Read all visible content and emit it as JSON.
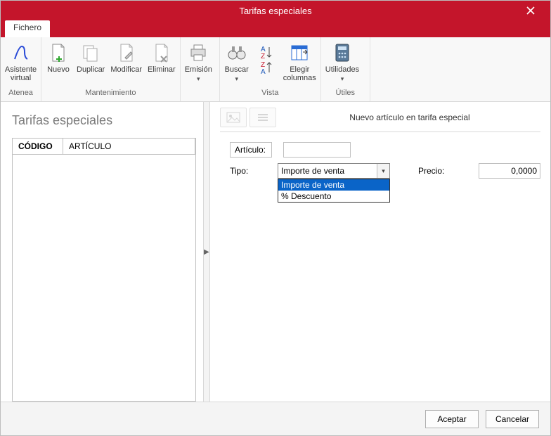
{
  "window": {
    "title": "Tarifas especiales"
  },
  "tabs": {
    "file": "Fichero"
  },
  "ribbon": {
    "group_atenea": {
      "label": "Atenea",
      "buttons": {
        "asistente": "Asistente\nvirtual"
      }
    },
    "group_mant": {
      "label": "Mantenimiento",
      "buttons": {
        "nuevo": "Nuevo",
        "duplicar": "Duplicar",
        "modificar": "Modificar",
        "eliminar": "Eliminar"
      }
    },
    "group_emision": {
      "label": "",
      "buttons": {
        "emision": "Emisión"
      }
    },
    "group_vista": {
      "label": "Vista",
      "buttons": {
        "buscar": "Buscar",
        "sort": "",
        "elegir": "Elegir\ncolumnas"
      }
    },
    "group_utiles": {
      "label": "Útiles",
      "buttons": {
        "utilidades": "Utilidades"
      }
    }
  },
  "left": {
    "title": "Tarifas especiales",
    "columns": {
      "codigo": "CÓDIGO",
      "articulo": "ARTÍCULO"
    }
  },
  "right": {
    "title": "Nuevo artículo en tarifa especial",
    "labels": {
      "articulo": "Artículo:",
      "tipo": "Tipo:",
      "precio": "Precio:"
    },
    "tipo": {
      "value": "Importe de venta",
      "options": [
        "Importe de venta",
        "% Descuento"
      ]
    },
    "precio_value": "0,0000"
  },
  "footer": {
    "aceptar": "Aceptar",
    "cancelar": "Cancelar"
  }
}
